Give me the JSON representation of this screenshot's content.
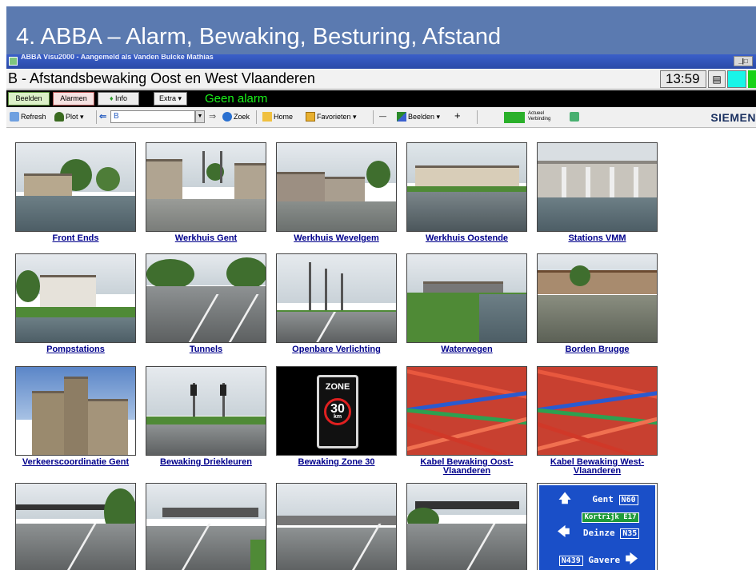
{
  "slide": {
    "title": "4. ABBA – Alarm, Bewaking, Besturing, Afstand"
  },
  "window": {
    "title": "ABBA Visu2000 - Aangemeld als Vanden Bulcke Mathias",
    "control": "_|□"
  },
  "screen": {
    "title": "B - Afstandsbewaking Oost en West Vlaanderen",
    "clock": "13:59",
    "doc_icon": "▤"
  },
  "alarm_bar": {
    "tabs": [
      {
        "label": "Beelden"
      },
      {
        "label": "Alarmen"
      },
      {
        "label": "Info",
        "icon": "leaf-icon"
      },
      {
        "label": "Extra ▾"
      }
    ],
    "status": "Geen alarm",
    "status_color": "#19f519"
  },
  "toolbar": {
    "refresh": "Refresh",
    "plot": "Plot ▾",
    "back": "⇐",
    "address": "B",
    "address_dropdown": "▼",
    "go": "⇒",
    "zoek": "Zoek",
    "home": "Home",
    "favorieten": "Favorieten ▾",
    "minus": "—",
    "beelden": "Beelden ▾",
    "plus": "+",
    "verbinding_line1": "Actueel",
    "verbinding_line2": "Verbinding",
    "brand": "SIEMEN"
  },
  "tiles": [
    {
      "label": "Front Ends",
      "scene": "canal-building"
    },
    {
      "label": "Werkhuis Gent",
      "scene": "depot-flags"
    },
    {
      "label": "Werkhuis Wevelgem",
      "scene": "depot"
    },
    {
      "label": "Werkhuis Oostende",
      "scene": "quay"
    },
    {
      "label": "Stations VMM",
      "scene": "sluice"
    },
    {
      "label": "Pompstations",
      "scene": "pump"
    },
    {
      "label": "Tunnels",
      "scene": "tunnel"
    },
    {
      "label": "Openbare Verlichting",
      "scene": "lighting"
    },
    {
      "label": "Waterwegen",
      "scene": "waterway"
    },
    {
      "label": "Borden Brugge",
      "scene": "bruges"
    },
    {
      "label": "Verkeerscoordinatie Gent",
      "scene": "gent-city"
    },
    {
      "label": "Bewaking Driekleuren",
      "scene": "traffic-lights"
    },
    {
      "label": "Bewaking Zone 30",
      "scene": "zone30"
    },
    {
      "label": "Kabel Bewaking Oost-Vlaanderen",
      "scene": "cables"
    },
    {
      "label": "Kabel Bewaking West-Vlaanderen",
      "scene": "cables"
    },
    {
      "label": "",
      "scene": "highway-a"
    },
    {
      "label": "",
      "scene": "highway-b"
    },
    {
      "label": "",
      "scene": "highway-c"
    },
    {
      "label": "",
      "scene": "highway-d"
    },
    {
      "label": "",
      "scene": "road-sign"
    }
  ],
  "zone_sign": {
    "top": "ZONE",
    "number": "30",
    "unit": "km"
  },
  "road_sign": {
    "row1_city": "Gent",
    "row1_route": "N60",
    "row2_green": "Kortrijk E17",
    "row2_city": "Deinze",
    "row2_route": "N35",
    "row3_route": "N439",
    "row3_city": "Gavere"
  }
}
